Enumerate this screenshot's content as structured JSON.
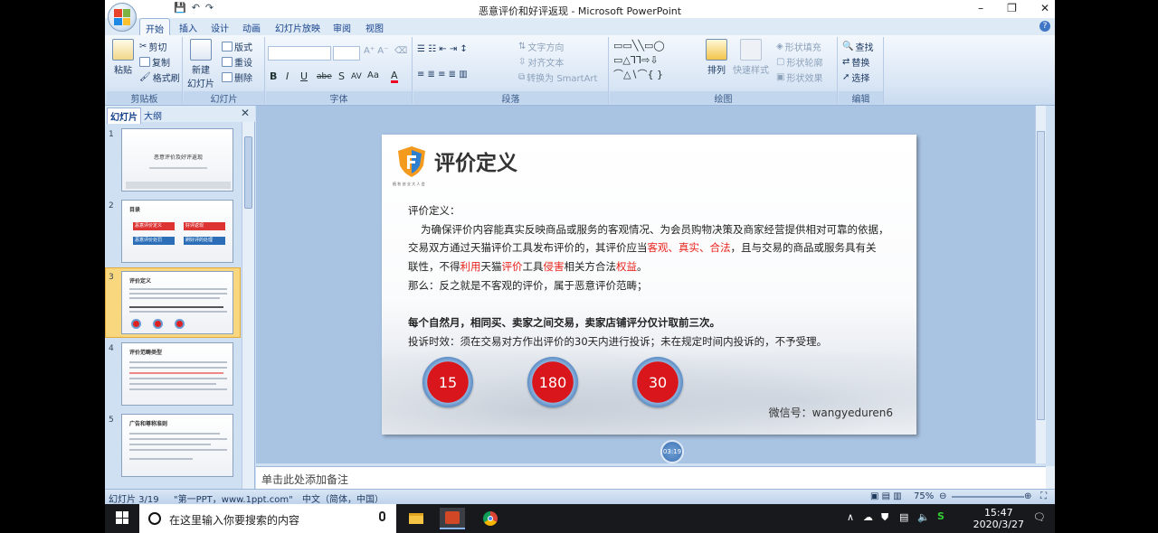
{
  "window": {
    "title": "恶意评价和好评返现 - Microsoft PowerPoint",
    "controls": [
      "–",
      "❐",
      "✕"
    ]
  },
  "tabs": [
    "开始",
    "插入",
    "设计",
    "动画",
    "幻灯片放映",
    "审阅",
    "视图"
  ],
  "ribbon": {
    "clipboard": {
      "label": "剪贴板",
      "paste": "粘贴",
      "cut": "剪切",
      "copy": "复制",
      "format_painter": "格式刷"
    },
    "slides": {
      "label": "幻灯片",
      "new_slide": "新建\n幻灯片",
      "layout": "版式",
      "reset": "重设",
      "delete": "删除"
    },
    "font": {
      "label": "字体",
      "buttons": [
        "B",
        "I",
        "U",
        "abe",
        "S",
        "AV",
        "Aa",
        "A"
      ]
    },
    "paragraph": {
      "label": "段落",
      "text_direction": "文字方向",
      "align_text": "对齐文本",
      "smartart": "转换为 SmartArt"
    },
    "drawing": {
      "label": "绘图",
      "arrange": "排列",
      "quick_styles": "快速样式",
      "shape_fill": "形状填充",
      "shape_outline": "形状轮廓",
      "shape_effects": "形状效果"
    },
    "editing": {
      "label": "编辑",
      "find": "查找",
      "replace": "替换",
      "select": "选择"
    }
  },
  "left_panel": {
    "tabs": [
      "幻灯片",
      "大纲"
    ],
    "close": "✕",
    "slides": [
      {
        "num": "1",
        "title": "恶意评价及好评返现"
      },
      {
        "num": "2",
        "title": "目录",
        "items": [
          "恶意评价定义",
          "好评返现",
          "恶意评价处罚",
          "刷好评的处理"
        ]
      },
      {
        "num": "3",
        "title": "评价定义"
      },
      {
        "num": "4",
        "title": "评价范畴类型"
      },
      {
        "num": "5",
        "title": "广告和尊称准则"
      }
    ]
  },
  "slide": {
    "title": "评价定义",
    "logo_caption": "植 秋 创 业 大 人 会",
    "lines": {
      "l1": "评价定义：",
      "l2": "为确保评价内容能真实反映商品或服务的客观情况、为会员购物决策及商家经营提供相对可靠的依据，",
      "l3_a": "交易双方通过天猫评价工具发布评价的，其评价应当",
      "l3_red": "客观、真实、合法",
      "l3_b": "，且与交易的商品或服务具有关",
      "l4_a": "联性，不得",
      "l4_r1": "利用",
      "l4_b": "天猫",
      "l4_r2": "评价",
      "l4_c": "工具",
      "l4_r3": "侵害",
      "l4_d": "相关方合法",
      "l4_r4": "权益",
      "l4_e": "。",
      "l5": "那么：反之就是不客观的评价，属于恶意评价范畴；",
      "l6": "每个自然月，相同买、卖家之间交易，卖家店铺评分仅计取前三次。",
      "l7": "投诉时效：须在交易对方作出评价的30天内进行投诉；未在规定时间内投诉的，不予受理。"
    },
    "circles": [
      "15",
      "180",
      "30"
    ],
    "wechat": "微信号：wangyeduren6",
    "badge": "03:19"
  },
  "notes_placeholder": "单击此处添加备注",
  "status": {
    "slide_index": "幻灯片 3/19",
    "theme": "\"第一PPT，www.1ppt.com\"",
    "language": "中文（简体，中国）",
    "zoom": "75%"
  },
  "taskbar": {
    "search_placeholder": "在这里输入你要搜索的内容",
    "time": "15:47",
    "date": "2020/3/27"
  },
  "colors": {
    "accent_red": "#e8231c",
    "ribbon_blue": "#15428b",
    "circle_red": "#d8161b"
  }
}
